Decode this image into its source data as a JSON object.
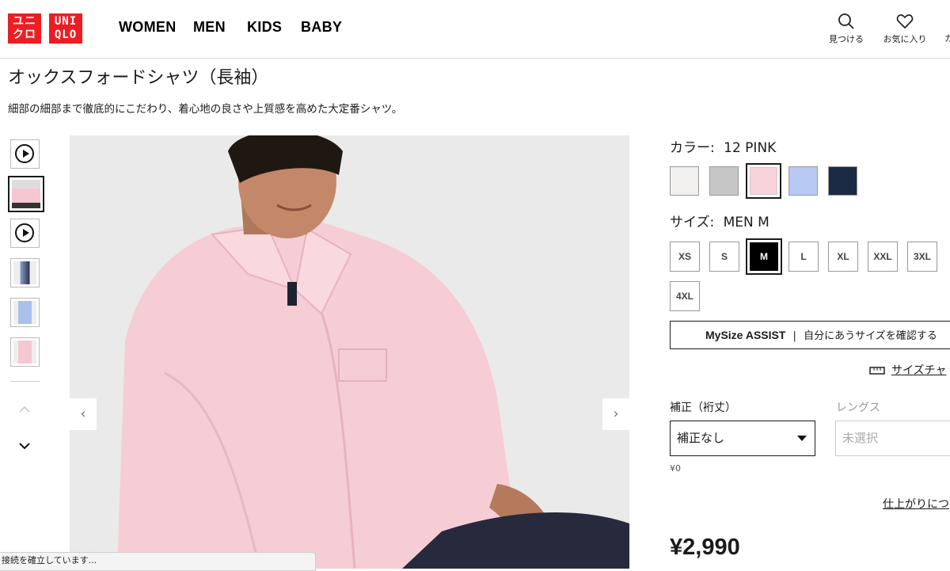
{
  "header": {
    "logo_left": [
      "ユニ",
      "クロ"
    ],
    "logo_right": [
      "UNI",
      "QLO"
    ],
    "nav": [
      "WOMEN",
      "MEN",
      "KIDS",
      "BABY"
    ],
    "search_label": "見つける",
    "favorites_label": "お気に入り",
    "brand_red": "#ed1d24"
  },
  "product": {
    "title": "オックスフォードシャツ（長袖）",
    "description": "細部の細部まで徹底的にこだわり、着心地の良さや上質感を高めた大定番シャツ。",
    "price": "¥2,990"
  },
  "gallery": {
    "thumbnails": [
      "video-play-icon",
      "pink-shirt-photo",
      "video-play-icon",
      "navy-outfit-photo",
      "blue-shirt-photo",
      "pink-shirt-photo"
    ],
    "prev_arrow": "‹",
    "next_arrow": "›",
    "up_chevron": "⌃",
    "down_chevron": "⌄"
  },
  "color": {
    "label": "カラー:",
    "selected": "12 PINK",
    "swatches": [
      "#f1f0ee",
      "#c7c6c6",
      "#f8d3dc",
      "#b8c9f3",
      "#1b2a45"
    ],
    "selected_index": 2
  },
  "size": {
    "label": "サイズ:",
    "selected": "MEN M",
    "options": [
      "XS",
      "S",
      "M",
      "L",
      "XL",
      "XXL",
      "3XL",
      "4XL"
    ],
    "selected_index": 2
  },
  "mysize": {
    "brand": "MySize ASSIST",
    "separator": "|",
    "text": "自分にあうサイズを確認する"
  },
  "size_chart_label": "サイズチャ",
  "fit": {
    "alter_label": "補正（裄丈）",
    "alter_value": "補正なし",
    "alter_price": "¥0",
    "length_label": "レングス",
    "length_placeholder": "未選択",
    "finish_link": "仕上がりにつ"
  },
  "status_bar": "接続を確立しています..."
}
